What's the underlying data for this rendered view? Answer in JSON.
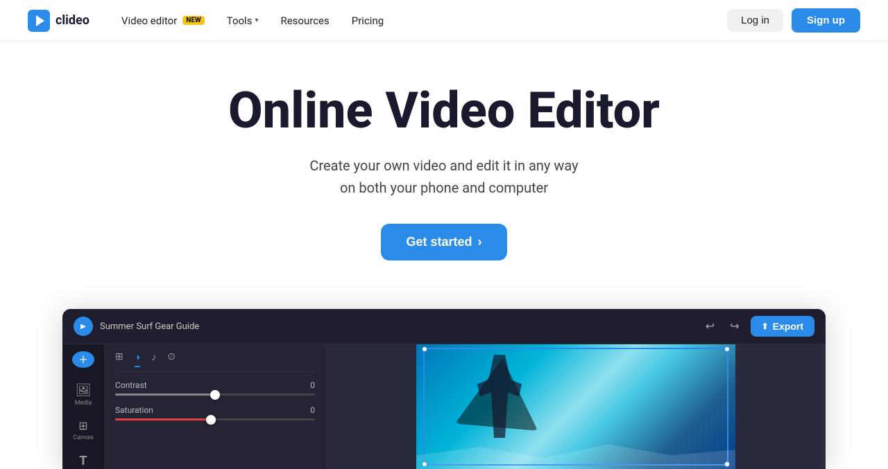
{
  "brand": {
    "name": "clideo",
    "logo_alt": "Clideo logo"
  },
  "nav": {
    "items": [
      {
        "id": "video-editor",
        "label": "Video editor",
        "badge": "NEW",
        "has_dropdown": false
      },
      {
        "id": "tools",
        "label": "Tools",
        "has_dropdown": true
      },
      {
        "id": "resources",
        "label": "Resources",
        "has_dropdown": false
      },
      {
        "id": "pricing",
        "label": "Pricing",
        "has_dropdown": false
      }
    ],
    "login_label": "Log in",
    "signup_label": "Sign up"
  },
  "hero": {
    "title": "Online Video Editor",
    "subtitle_line1": "Create your own video and edit it in any way",
    "subtitle_line2": "on both your phone and computer",
    "cta_label": "Get started",
    "cta_arrow": "›"
  },
  "editor": {
    "title": "Summer Surf Gear Guide",
    "export_label": "Export",
    "undo_label": "↩",
    "redo_label": "↪",
    "sidebar_tools": [
      {
        "id": "media",
        "icon": "🖼",
        "label": "Media"
      },
      {
        "id": "canvas",
        "icon": "⊞",
        "label": "Canvas"
      },
      {
        "id": "text",
        "icon": "T",
        "label": ""
      }
    ],
    "controls": {
      "tabs": [
        "grid",
        "contrast",
        "audio",
        "effects"
      ],
      "active_tab": 1,
      "sliders": [
        {
          "label": "Contrast",
          "value": 0,
          "fill_pct": 50,
          "type": "neutral"
        },
        {
          "label": "Saturation",
          "value": 0,
          "fill_pct": 48,
          "type": "red"
        }
      ]
    }
  },
  "colors": {
    "accent": "#2b8be8",
    "bg_dark": "#1e1e2e",
    "badge_bg": "#f5c518"
  }
}
